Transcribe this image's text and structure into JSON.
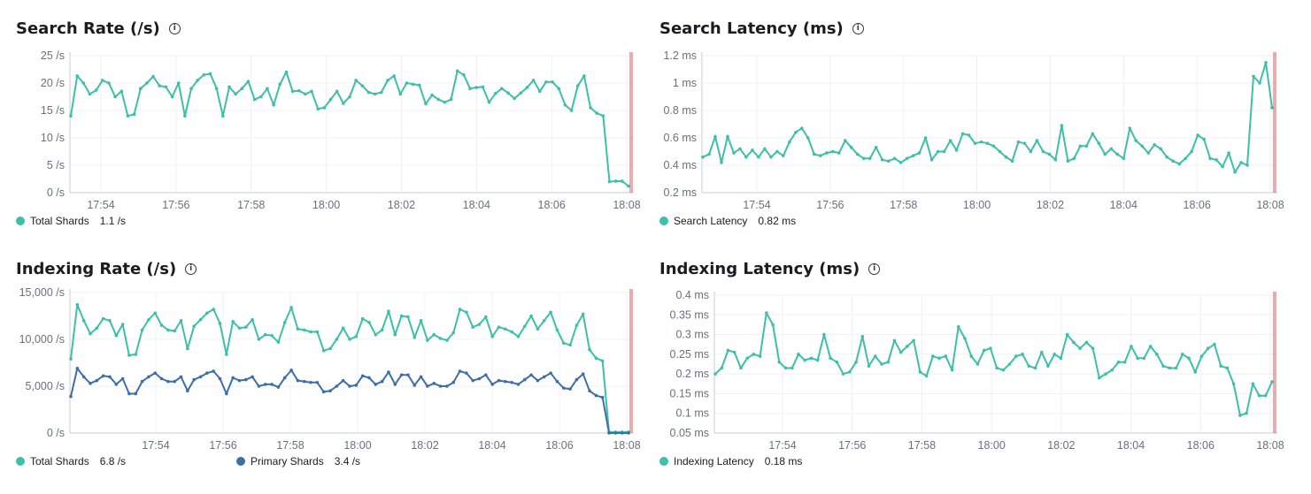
{
  "colors": {
    "teal": "#3ebfaa",
    "blue": "#3e6ea8",
    "marker": "#d5595d",
    "grid": "#eef0f3",
    "axis": "#c9ccd2"
  },
  "chart_data": [
    {
      "type": "line",
      "title": "Search Rate (/s)",
      "x_ticks": [
        "17:54",
        "17:56",
        "17:58",
        "18:00",
        "18:02",
        "18:04",
        "18:06",
        "18:08"
      ],
      "y_ticks": [
        "0 /s",
        "5 /s",
        "10 /s",
        "15 /s",
        "20 /s",
        "25 /s"
      ],
      "ylim": [
        0,
        25
      ],
      "series": [
        {
          "name": "Total Shards",
          "last_value": "1.1 /s",
          "values": [
            14,
            21.3,
            20,
            18,
            18.7,
            20.5,
            20,
            17.5,
            18.5,
            14,
            14.3,
            19,
            20,
            21.2,
            19.5,
            19.3,
            17.5,
            20,
            14,
            19,
            20.5,
            21.5,
            21.7,
            19,
            14,
            19.3,
            18,
            19,
            20.3,
            17,
            17.5,
            19,
            16,
            19.8,
            22,
            18.5,
            18.6,
            18,
            18.5,
            15.3,
            15.5,
            17,
            18.5,
            16.3,
            17.5,
            20.5,
            19.5,
            18.3,
            18,
            18.3,
            20.5,
            21.3,
            18,
            20,
            19.8,
            19.6,
            16.2,
            17.8,
            17,
            16.5,
            17,
            22.2,
            21.5,
            19,
            19.2,
            19.3,
            16.5,
            18.1,
            19,
            18.2,
            17.2,
            18.2,
            19.2,
            20.5,
            18.5,
            20.2,
            20.2,
            19,
            16,
            15,
            19.5,
            21.3,
            15.5,
            14.5,
            14,
            2,
            2.1,
            2.1,
            1.2
          ]
        }
      ]
    },
    {
      "type": "line",
      "title": "Search Latency (ms)",
      "x_ticks": [
        "17:54",
        "17:56",
        "17:58",
        "18:00",
        "18:02",
        "18:04",
        "18:06",
        "18:08"
      ],
      "y_ticks": [
        "0.2 ms",
        "0.4 ms",
        "0.6 ms",
        "0.8 ms",
        "1 ms",
        "1.2 ms"
      ],
      "ylim": [
        0.2,
        1.2
      ],
      "series": [
        {
          "name": "Search Latency",
          "last_value": "0.82 ms",
          "values": [
            0.46,
            0.48,
            0.61,
            0.42,
            0.61,
            0.49,
            0.52,
            0.46,
            0.51,
            0.46,
            0.52,
            0.46,
            0.5,
            0.47,
            0.57,
            0.64,
            0.67,
            0.6,
            0.48,
            0.47,
            0.49,
            0.5,
            0.49,
            0.58,
            0.53,
            0.48,
            0.45,
            0.45,
            0.53,
            0.44,
            0.43,
            0.45,
            0.42,
            0.45,
            0.47,
            0.49,
            0.6,
            0.44,
            0.5,
            0.5,
            0.58,
            0.51,
            0.63,
            0.62,
            0.56,
            0.57,
            0.56,
            0.54,
            0.5,
            0.46,
            0.43,
            0.57,
            0.56,
            0.5,
            0.58,
            0.5,
            0.48,
            0.44,
            0.69,
            0.43,
            0.45,
            0.54,
            0.54,
            0.63,
            0.56,
            0.48,
            0.52,
            0.48,
            0.45,
            0.67,
            0.58,
            0.54,
            0.49,
            0.55,
            0.52,
            0.46,
            0.43,
            0.41,
            0.45,
            0.5,
            0.62,
            0.59,
            0.45,
            0.44,
            0.39,
            0.49,
            0.35,
            0.42,
            0.4,
            1.05,
            1.0,
            1.15,
            0.82
          ]
        }
      ]
    },
    {
      "type": "line",
      "title": "Indexing Rate (/s)",
      "x_ticks": [
        "17:54",
        "17:56",
        "17:58",
        "18:00",
        "18:02",
        "18:04",
        "18:06",
        "18:08"
      ],
      "y_ticks": [
        "0 /s",
        "5,000 /s",
        "10,000 /s",
        "15,000 /s"
      ],
      "ylim": [
        0,
        15000
      ],
      "series": [
        {
          "name": "Total Shards",
          "last_value": "6.8 /s",
          "values": [
            7900,
            13700,
            12000,
            10600,
            11200,
            12200,
            12000,
            10400,
            11600,
            8300,
            8400,
            11000,
            12100,
            12800,
            11500,
            11000,
            10900,
            12000,
            9000,
            11400,
            12100,
            12800,
            13200,
            11700,
            8400,
            11900,
            11200,
            11300,
            12100,
            10000,
            10500,
            10400,
            9700,
            11800,
            13400,
            11100,
            11000,
            10800,
            10800,
            8800,
            9000,
            10000,
            11200,
            10000,
            10300,
            12200,
            11800,
            10500,
            11000,
            13000,
            10500,
            12500,
            12400,
            10200,
            12000,
            9900,
            10500,
            10100,
            9900,
            10700,
            13200,
            12900,
            11300,
            11600,
            12400,
            10300,
            11300,
            11100,
            10800,
            10300,
            11400,
            12500,
            11100,
            12000,
            12900,
            11000,
            9600,
            9400,
            11500,
            12700,
            8900,
            8000,
            7700,
            100,
            100,
            100,
            100
          ]
        },
        {
          "name": "Primary Shards",
          "last_value": "3.4 /s",
          "values": [
            3900,
            6900,
            6000,
            5300,
            5600,
            6100,
            6000,
            5200,
            5800,
            4200,
            4200,
            5500,
            6000,
            6400,
            5800,
            5500,
            5500,
            6000,
            4500,
            5700,
            6000,
            6400,
            6600,
            5800,
            4200,
            5900,
            5600,
            5700,
            6000,
            5000,
            5200,
            5200,
            4900,
            5900,
            6700,
            5600,
            5500,
            5400,
            5400,
            4400,
            4500,
            5000,
            5600,
            5000,
            5100,
            6100,
            5900,
            5200,
            5500,
            6500,
            5200,
            6200,
            6200,
            5100,
            6000,
            5000,
            5300,
            5000,
            5000,
            5400,
            6600,
            6400,
            5600,
            5800,
            6200,
            5200,
            5600,
            5500,
            5400,
            5200,
            5700,
            6200,
            5600,
            6000,
            6400,
            5500,
            4800,
            4700,
            5700,
            6300,
            4500,
            4000,
            3800,
            0,
            0,
            0,
            0
          ]
        }
      ]
    },
    {
      "type": "line",
      "title": "Indexing Latency (ms)",
      "x_ticks": [
        "17:54",
        "17:56",
        "17:58",
        "18:00",
        "18:02",
        "18:04",
        "18:06",
        "18:08"
      ],
      "y_ticks": [
        "0.05 ms",
        "0.1 ms",
        "0.15 ms",
        "0.2 ms",
        "0.25 ms",
        "0.3 ms",
        "0.35 ms",
        "0.4 ms"
      ],
      "ylim": [
        0.05,
        0.4
      ],
      "series": [
        {
          "name": "Indexing Latency",
          "last_value": "0.18 ms",
          "values": [
            0.2,
            0.215,
            0.26,
            0.255,
            0.215,
            0.24,
            0.25,
            0.245,
            0.355,
            0.325,
            0.23,
            0.215,
            0.215,
            0.25,
            0.235,
            0.24,
            0.235,
            0.3,
            0.24,
            0.23,
            0.2,
            0.205,
            0.23,
            0.295,
            0.22,
            0.245,
            0.225,
            0.23,
            0.285,
            0.255,
            0.27,
            0.285,
            0.205,
            0.195,
            0.245,
            0.24,
            0.245,
            0.21,
            0.32,
            0.29,
            0.245,
            0.225,
            0.26,
            0.265,
            0.215,
            0.21,
            0.225,
            0.245,
            0.25,
            0.22,
            0.215,
            0.255,
            0.22,
            0.25,
            0.24,
            0.3,
            0.28,
            0.265,
            0.28,
            0.265,
            0.19,
            0.2,
            0.21,
            0.23,
            0.23,
            0.27,
            0.24,
            0.24,
            0.27,
            0.25,
            0.22,
            0.215,
            0.215,
            0.25,
            0.24,
            0.205,
            0.245,
            0.265,
            0.275,
            0.22,
            0.215,
            0.175,
            0.095,
            0.1,
            0.175,
            0.145,
            0.145,
            0.18
          ]
        }
      ]
    }
  ]
}
